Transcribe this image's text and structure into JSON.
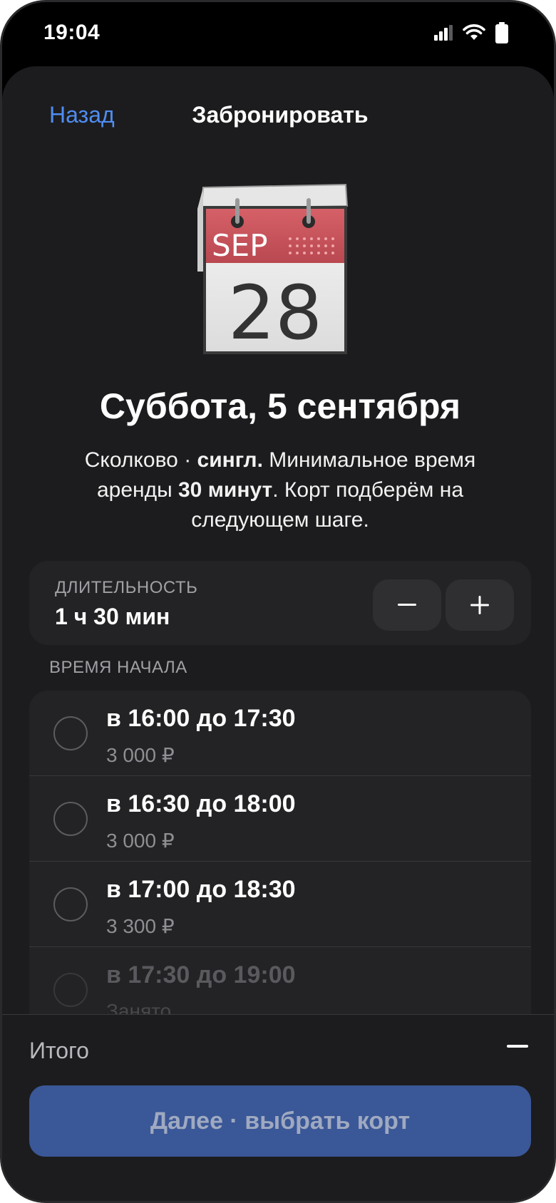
{
  "status_bar": {
    "time": "19:04"
  },
  "nav": {
    "back_label": "Назад",
    "title": "Забронировать"
  },
  "calendar_icon": {
    "month": "SEP",
    "day": "28"
  },
  "header": {
    "date_title": "Суббота, 5 сентября"
  },
  "subtitle": {
    "part1": "Сколково · ",
    "bold1": "сингл.",
    "part2": " Минимальное время аренды ",
    "bold2": "30 минут",
    "part3": ". Корт подберём на следующем шаге."
  },
  "duration": {
    "label": "ДЛИТЕЛЬНОСТЬ",
    "value": "1 ч 30 мин",
    "minus_label": "−",
    "plus_label": "+"
  },
  "start_time": {
    "label": "ВРЕМЯ НАЧАЛА",
    "slots": [
      {
        "title": "в 16:00 до 17:30",
        "price": "3 000 ₽",
        "available": true
      },
      {
        "title": "в 16:30 до 18:00",
        "price": "3 000 ₽",
        "available": true
      },
      {
        "title": "в 17:00 до 18:30",
        "price": "3 300 ₽",
        "available": true
      },
      {
        "title": "в 17:30 до 19:00",
        "price": "Занято",
        "available": false
      }
    ]
  },
  "footer": {
    "total_label": "Итого",
    "next_button_label": "Далее · выбрать корт"
  },
  "colors": {
    "accent": "#4f8df2",
    "button_bg": "#3a5797",
    "calendar_red": "#c9545c"
  }
}
